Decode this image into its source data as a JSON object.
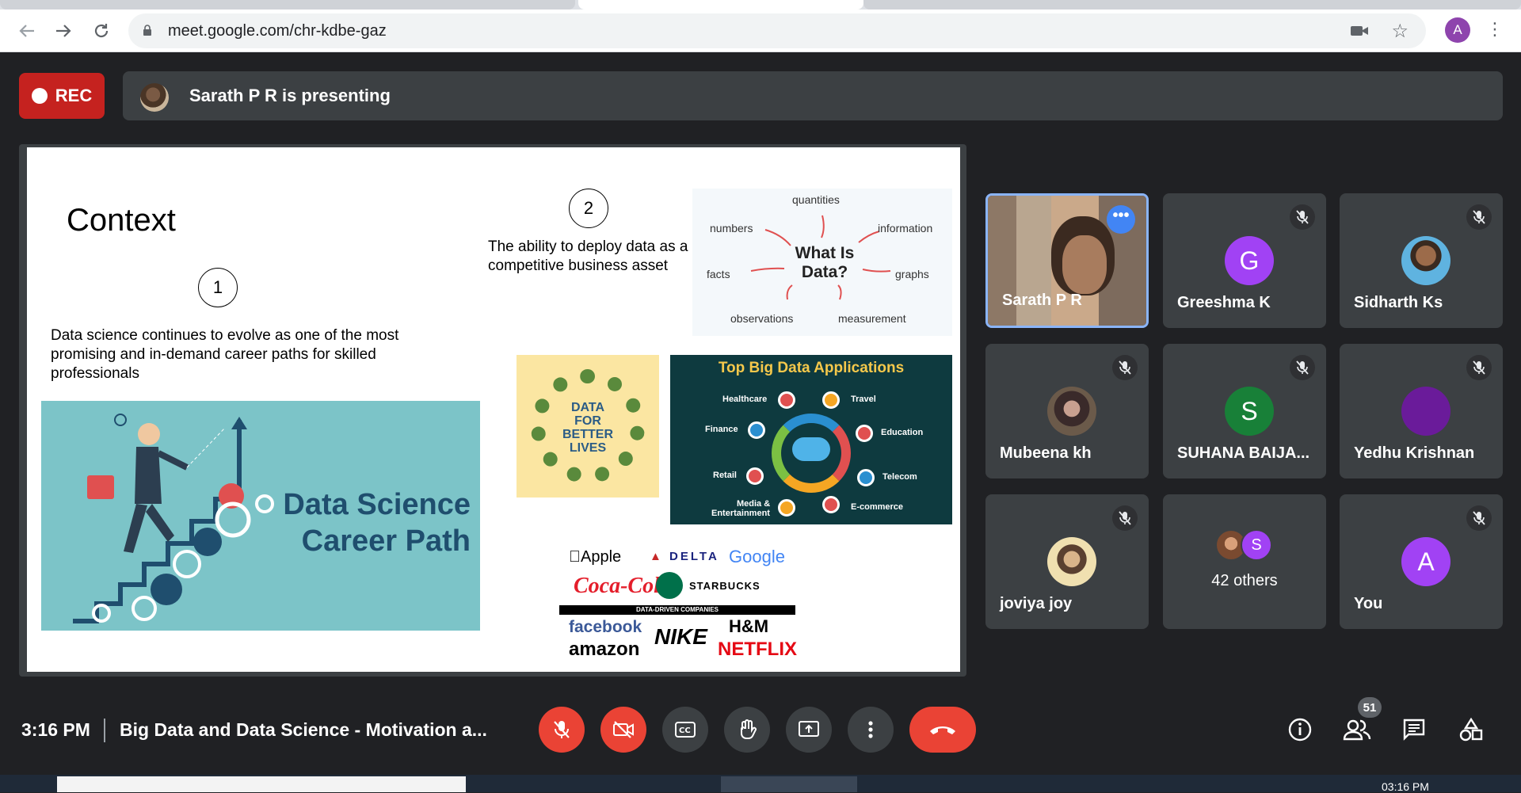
{
  "browser": {
    "url": "meet.google.com/chr-kdbe-gaz",
    "profile_initial": "A"
  },
  "meet": {
    "rec_label": "REC",
    "presenting_text": "Sarath P R is presenting"
  },
  "slide": {
    "title": "Context",
    "num1": "1",
    "num2": "2",
    "point1": "Data science continues to evolve as one of the most promising and in-demand career paths for skilled professionals",
    "point2": "The ability to deploy data as a competitive business asset",
    "wordcloud": {
      "center_line1": "What Is",
      "center_line2": "Data?",
      "words": [
        "quantities",
        "numbers",
        "information",
        "facts",
        "graphs",
        "observations",
        "measurement"
      ]
    },
    "banner_line1": "Data Science",
    "banner_line2": "Career Path",
    "data_better": [
      "DATA",
      "FOR",
      "BETTER",
      "LIVES"
    ],
    "bigdata": {
      "title": "Top Big Data Applications",
      "items": [
        "Healthcare",
        "Travel",
        "Finance",
        "Education",
        "Retail",
        "Telecom",
        "Media &",
        "Entertainment",
        "E-commerce"
      ]
    },
    "logos": {
      "apple": "Apple",
      "delta": "DELTA",
      "google": "Google",
      "cocacola": "Coca-Cola",
      "starbucks": "STARBUCKS",
      "bar": "DATA-DRIVEN COMPANIES",
      "facebook": "facebook",
      "amazon": "amazon",
      "nike": "NIKE",
      "hm": "H&M",
      "netflix": "NETFLIX"
    }
  },
  "participants": [
    {
      "name": "Sarath P R",
      "type": "video",
      "active": true
    },
    {
      "name": "Greeshma K",
      "initial": "G",
      "color": "#a142f4"
    },
    {
      "name": "Sidharth Ks",
      "type": "photo"
    },
    {
      "name": "Mubeena kh",
      "type": "photo"
    },
    {
      "name": "SUHANA BAIJA...",
      "initial": "S",
      "color": "#188038"
    },
    {
      "name": "Yedhu Krishnan",
      "initial": "",
      "color": "#6a1b9a"
    },
    {
      "name": "joviya joy",
      "type": "photo"
    },
    {
      "name": "42 others",
      "initial": "S",
      "color": "#a142f4"
    },
    {
      "name": "You",
      "initial": "A",
      "color": "#a142f4"
    }
  ],
  "bottom": {
    "time": "3:16 PM",
    "meeting_title": "Big Data and Data Science - Motivation a...",
    "people_count": "51"
  },
  "taskbar": {
    "time": "03:16 PM"
  },
  "colors": {
    "meet_bg": "#202124",
    "tile_bg": "#3c4043",
    "red": "#ea4335",
    "accent": "#8ab4f8"
  }
}
